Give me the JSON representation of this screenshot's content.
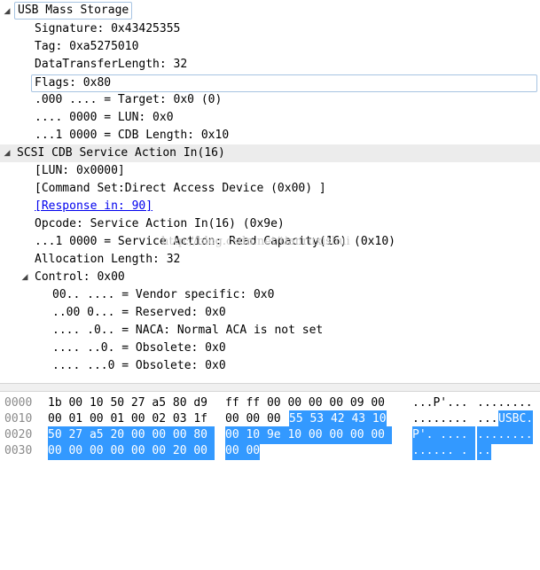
{
  "tree": {
    "usb": {
      "title": "USB Mass Storage",
      "signature": "Signature: 0x43425355",
      "tag": "Tag: 0xa5275010",
      "length": "DataTransferLength: 32",
      "flags": "Flags: 0x80",
      "target": ".000 .... = Target: 0x0 (0)",
      "lun": ".... 0000 = LUN: 0x0",
      "cdb_length": "...1 0000 = CDB Length: 0x10"
    },
    "scsi": {
      "title": "SCSI CDB Service Action In(16)",
      "lun": "[LUN: 0x0000]",
      "command_set": "[Command Set:Direct Access Device (0x00) ]",
      "response": "[Response in: 90]",
      "opcode": "Opcode: Service Action In(16) (0x9e)",
      "service_action": "...1 0000 = Service Action: Read Capacity(16) (0x10)",
      "allocation": "Allocation Length: 32",
      "control": {
        "label": "Control: 0x00",
        "vendor": "00.. .... = Vendor specific: 0x0",
        "reserved": "..00 0... = Reserved: 0x0",
        "naca": ".... .0.. = NACA: Normal ACA is not set",
        "obsolete1": ".... ..0. = Obsolete: 0x0",
        "obsolete0": ".... ...0 = Obsolete: 0x0"
      }
    }
  },
  "hex": {
    "rows": [
      {
        "offset": "0000",
        "hex_a": "1b 00 10 50 27 a5 80 d9",
        "hex_b": "ff ff 00 00 00 00 09 00",
        "ascii_a": "...P'...",
        "ascii_b": "........"
      },
      {
        "offset": "0010",
        "hex_a": "00 01 00 01 00 02 03 1f",
        "hex_b_plain": "00 00 00",
        "hex_b_sel": "55 53 42 43 10",
        "ascii_a": "........",
        "ascii_b_plain": "...",
        "ascii_b_sel": "USBC."
      },
      {
        "offset": "0020",
        "hex_a_sel": "50 27 a5 20 00 00 00 80",
        "hex_b_sel": "00 10 9e 10 00 00 00 00",
        "ascii_a_sel": "P'. ....",
        "ascii_b_sel": "........"
      },
      {
        "offset": "0030",
        "hex_a_sel": "00 00 00 00 00 00 20 00",
        "hex_b_sel": "00 00",
        "ascii_a_sel": "...... .",
        "ascii_b_sel": ".."
      }
    ]
  },
  "watermark": "http://blog.csdn.net/tianruxishui",
  "colors": {
    "selection": "#3399ff",
    "header_bg": "#ececec",
    "link": "#0000ee",
    "offset_text": "#8a8a8a"
  },
  "icons": {
    "expanded": "expanded-triangle-icon"
  }
}
